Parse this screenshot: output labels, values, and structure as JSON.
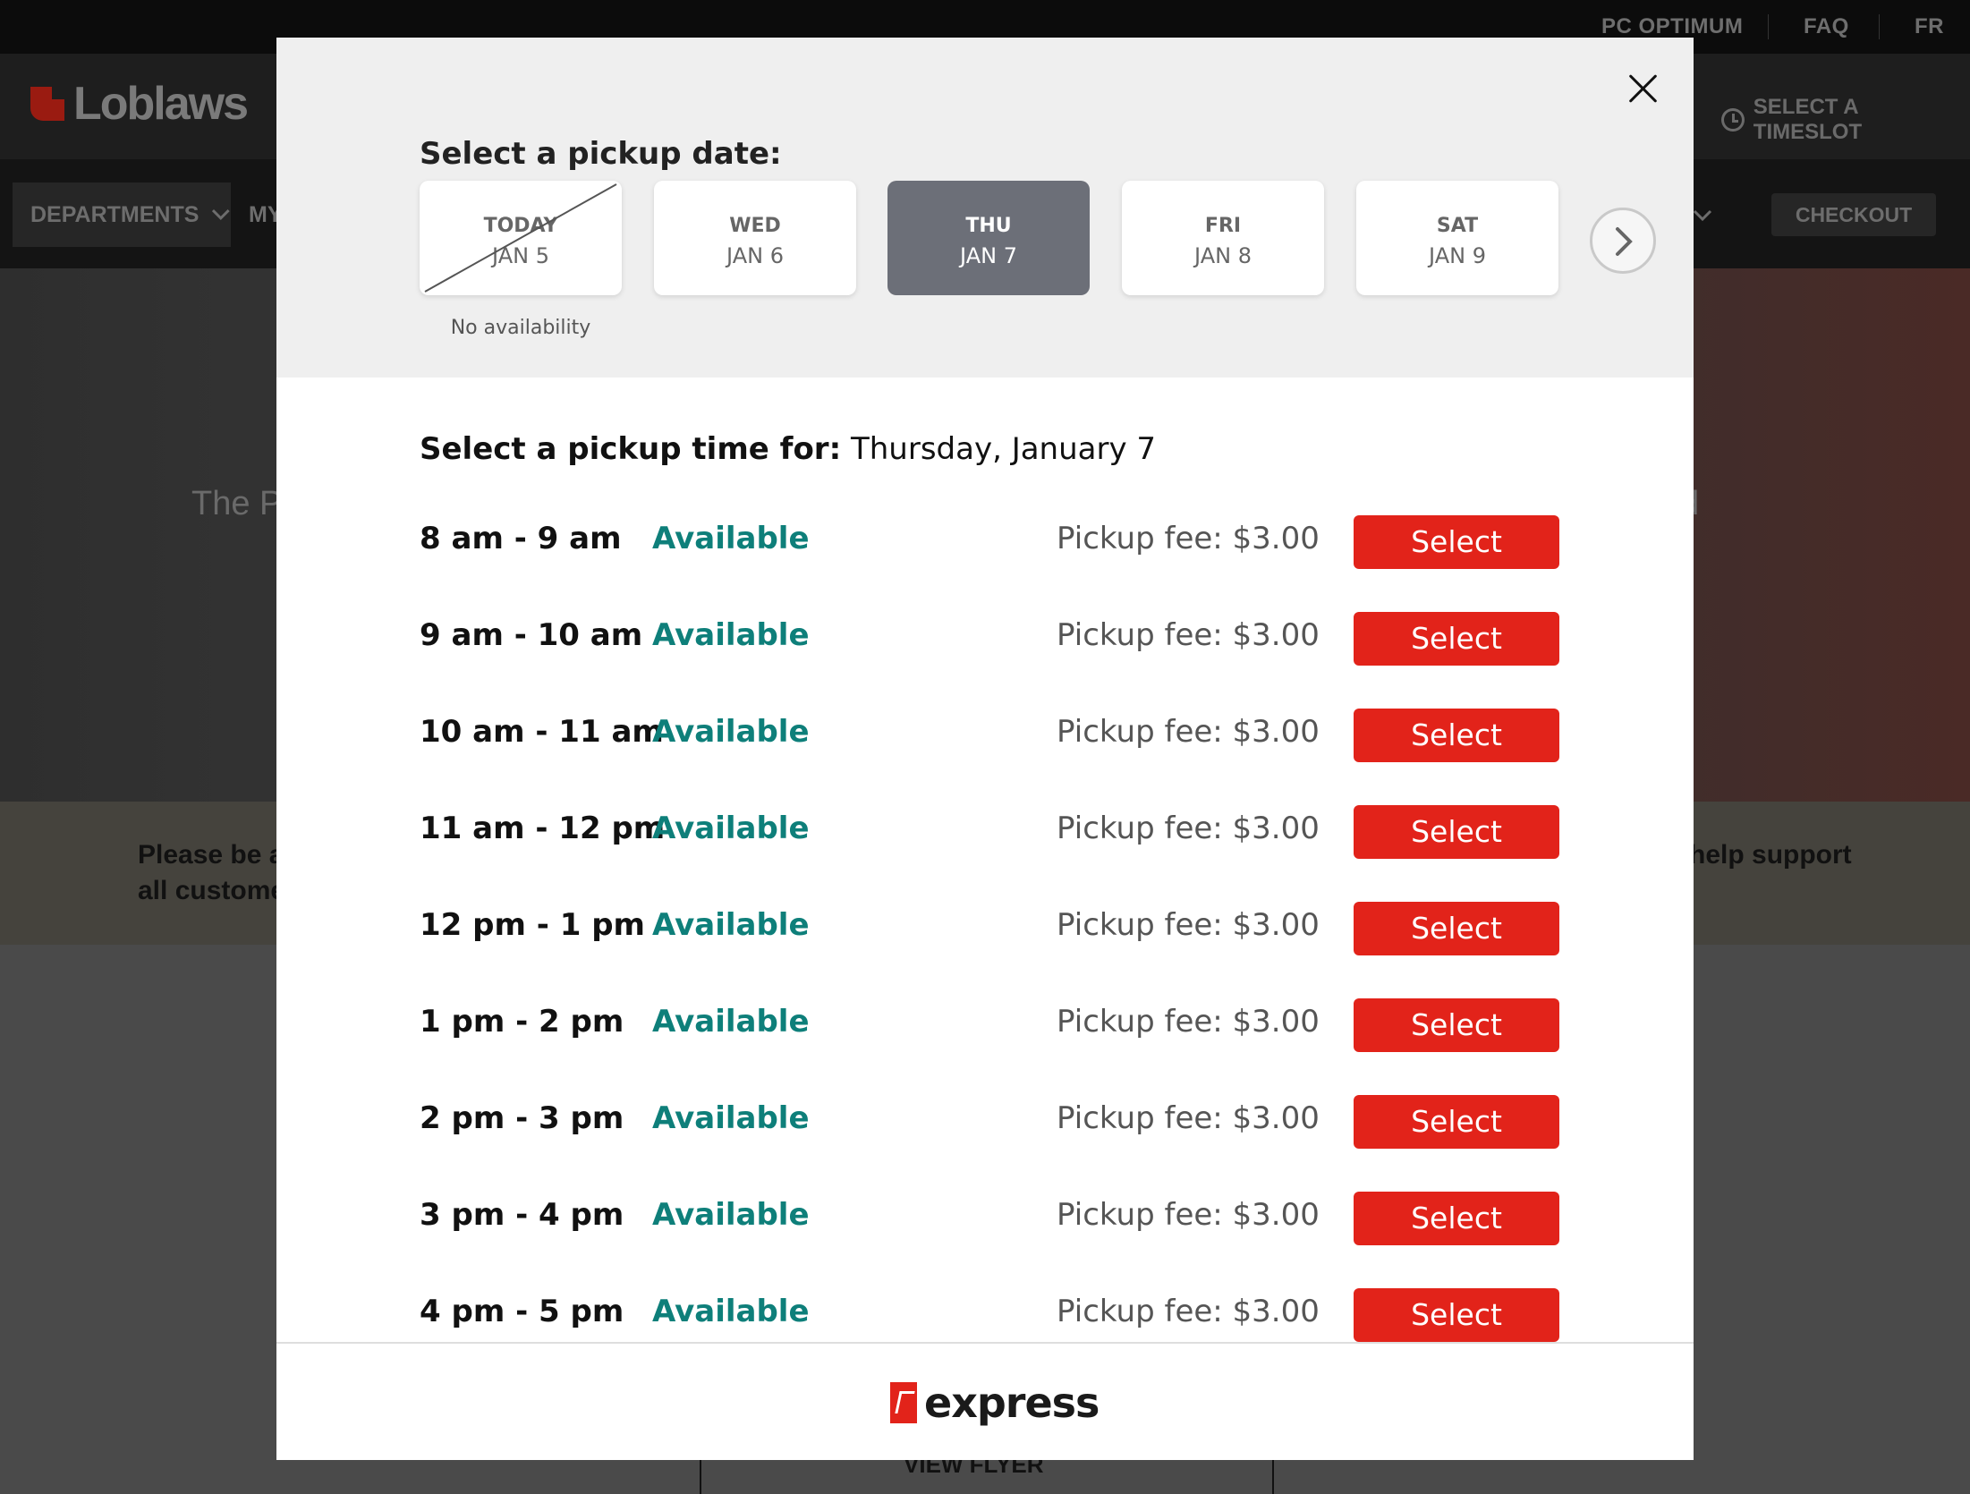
{
  "background": {
    "utility_links": [
      "PC OPTIMUM",
      "FAQ",
      "FR"
    ],
    "brand": "Loblaws",
    "timeslot_label": "SELECT A TIMESLOT",
    "departments_label": "DEPARTMENTS",
    "nav_partial": "MY",
    "checkout_label": "CHECKOUT",
    "hero_left": "The P",
    "hero_right": "d",
    "notice_left_line1": "Please be aw",
    "notice_left_line2": "all customer",
    "notice_right_line1": "help support",
    "flyer_label": "VIEW FLYER"
  },
  "modal": {
    "date_heading": "Select a pickup date:",
    "dates": [
      {
        "dow": "TODAY",
        "date": "JAN 5",
        "note": "No availability",
        "state": "unavailable"
      },
      {
        "dow": "WED",
        "date": "JAN 6",
        "state": "default"
      },
      {
        "dow": "THU",
        "date": "JAN 7",
        "state": "selected"
      },
      {
        "dow": "FRI",
        "date": "JAN 8",
        "state": "default"
      },
      {
        "dow": "SAT",
        "date": "JAN 9",
        "state": "default"
      }
    ],
    "time_heading_label": "Select a pickup time for:",
    "time_heading_date": "Thursday, January 7",
    "slots": [
      {
        "time": "8 am - 9 am",
        "status": "Available",
        "fee": "Pickup fee: $3.00",
        "button": "Select"
      },
      {
        "time": "9 am - 10 am",
        "status": "Available",
        "fee": "Pickup fee: $3.00",
        "button": "Select"
      },
      {
        "time": "10 am - 11 am",
        "status": "Available",
        "fee": "Pickup fee: $3.00",
        "button": "Select"
      },
      {
        "time": "11 am - 12 pm",
        "status": "Available",
        "fee": "Pickup fee: $3.00",
        "button": "Select"
      },
      {
        "time": "12 pm - 1 pm",
        "status": "Available",
        "fee": "Pickup fee: $3.00",
        "button": "Select"
      },
      {
        "time": "1 pm - 2 pm",
        "status": "Available",
        "fee": "Pickup fee: $3.00",
        "button": "Select"
      },
      {
        "time": "2 pm - 3 pm",
        "status": "Available",
        "fee": "Pickup fee: $3.00",
        "button": "Select"
      },
      {
        "time": "3 pm - 4 pm",
        "status": "Available",
        "fee": "Pickup fee: $3.00",
        "button": "Select"
      },
      {
        "time": "4 pm - 5 pm",
        "status": "Available",
        "fee": "Pickup fee: $3.00",
        "button": "Select"
      }
    ],
    "footer_brand": "express"
  },
  "icons": {
    "close": "close-icon",
    "next": "chevron-right-icon",
    "clock": "clock-icon",
    "dept_chevron": "chevron-down-icon"
  },
  "colors": {
    "accent_red": "#e2231a",
    "available_teal": "#0e7f7a",
    "selected_date_bg": "#6c6f78"
  }
}
